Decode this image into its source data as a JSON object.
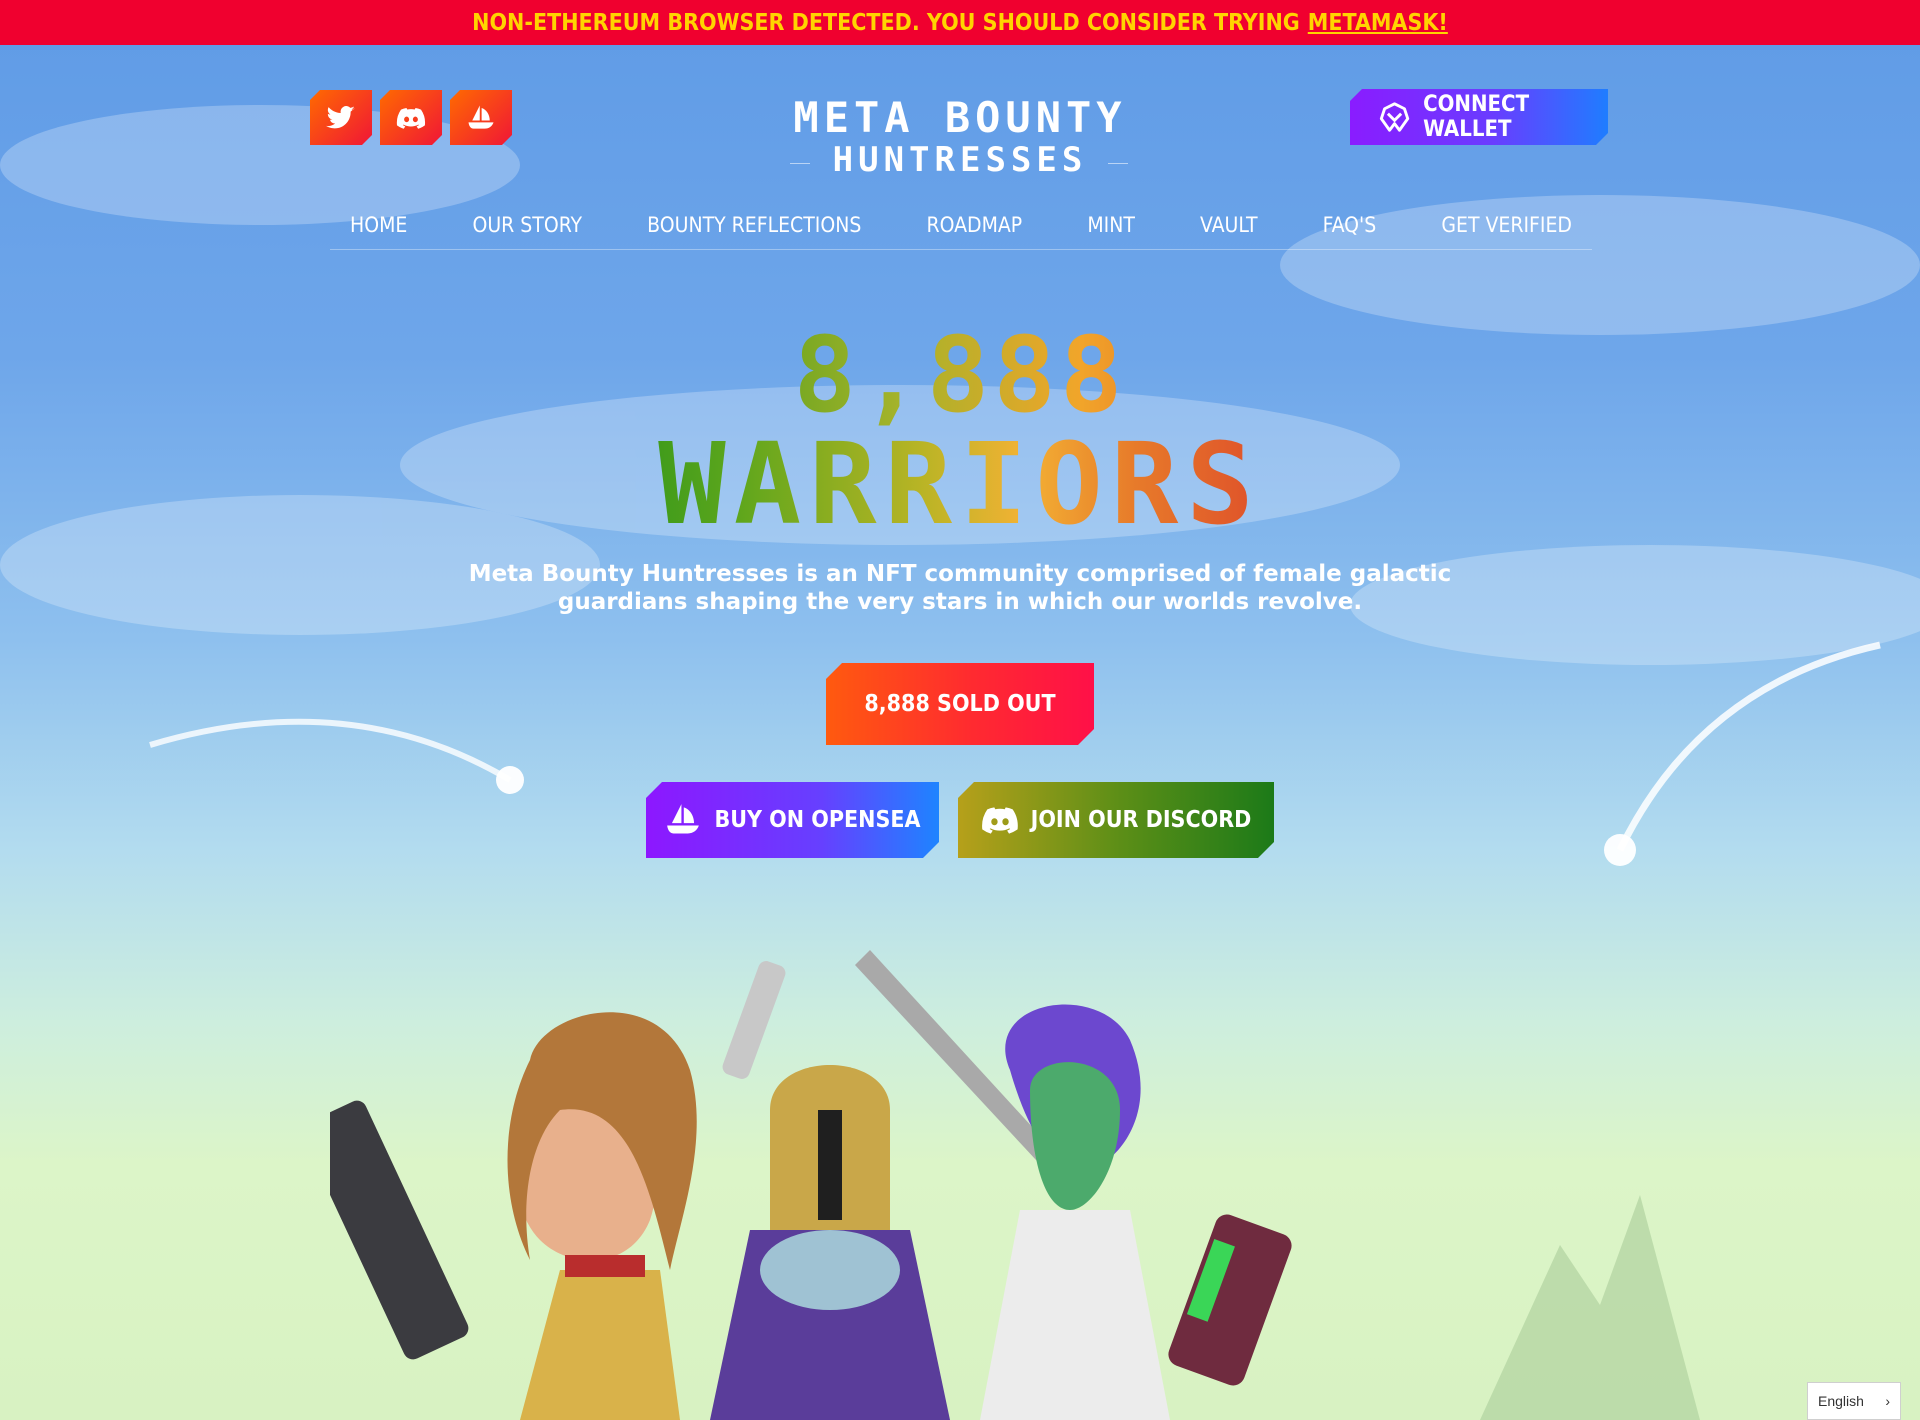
{
  "banner": {
    "text": "NON-ETHEREUM BROWSER DETECTED. YOU SHOULD CONSIDER TRYING",
    "link": "METAMASK!"
  },
  "socials": [
    {
      "icon": "twitter-icon"
    },
    {
      "icon": "discord-icon"
    },
    {
      "icon": "opensea-icon"
    }
  ],
  "logo": {
    "line1": "META BOUNTY",
    "line2": "HUNTRESSES"
  },
  "connect_wallet": {
    "label": "CONNECT WALLET",
    "icon": "wallet-logo-icon"
  },
  "nav": {
    "items": [
      "HOME",
      "OUR STORY",
      "BOUNTY REFLECTIONS",
      "ROADMAP",
      "MINT",
      "VAULT",
      "FAQ'S",
      "GET VERIFIED"
    ]
  },
  "hero": {
    "number": "8,888",
    "word": "WARRIORS",
    "description": "Meta Bounty Huntresses is an NFT community comprised of female galactic guardians shaping the very stars in which our worlds revolve."
  },
  "buttons": {
    "sold_out": "8,888 SOLD OUT",
    "opensea": "BUY ON OPENSEA",
    "discord": "JOIN OUR DISCORD"
  },
  "language": {
    "label": "English"
  },
  "colors": {
    "banner_bg": "#f0002f",
    "banner_text": "#ffd400",
    "social_gradient": [
      "#ff6a00",
      "#f01636"
    ],
    "wallet_gradient": [
      "#8a1cff",
      "#1f7dff"
    ]
  }
}
